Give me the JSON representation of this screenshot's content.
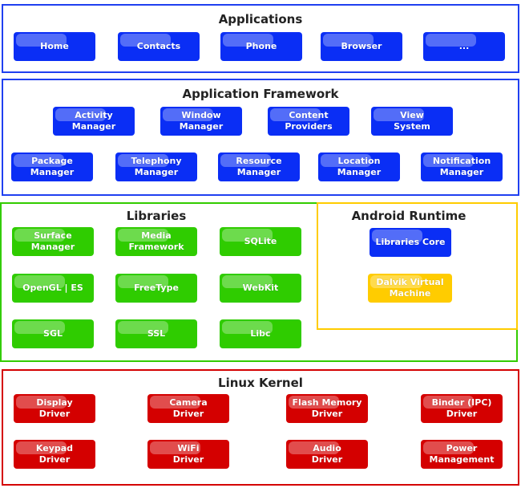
{
  "colors": {
    "blue": "#0a2ef5",
    "green": "#2fcc00",
    "yellow": "#ffcc00",
    "red": "#d40000"
  },
  "applications": {
    "title": "Applications",
    "items": [
      "Home",
      "Contacts",
      "Phone",
      "Browser",
      "..."
    ]
  },
  "framework": {
    "title": "Application Framework",
    "items": [
      "Activity\nManager",
      "Window\nManager",
      "Content\nProviders",
      "View\nSystem",
      "Package\nManager",
      "Telephony\nManager",
      "Resource\nManager",
      "Location\nManager",
      "Notification\nManager"
    ]
  },
  "libraries": {
    "title": "Libraries",
    "items": [
      "Surface\nManager",
      "Media\nFramework",
      "SQLite",
      "OpenGL | ES",
      "FreeType",
      "WebKit",
      "SGL",
      "SSL",
      "Libc"
    ]
  },
  "runtime": {
    "title": "Android Runtime",
    "items": [
      "Libraries Core",
      "Dalvik Virtual\nMachine"
    ]
  },
  "kernel": {
    "title": "Linux Kernel",
    "items": [
      "Display\nDriver",
      "Camera\nDriver",
      "Flash Memory\nDriver",
      "Binder (IPC)\nDriver",
      "Keypad\nDriver",
      "WiFi\nDriver",
      "Audio\nDriver",
      "Power\nManagement"
    ]
  }
}
